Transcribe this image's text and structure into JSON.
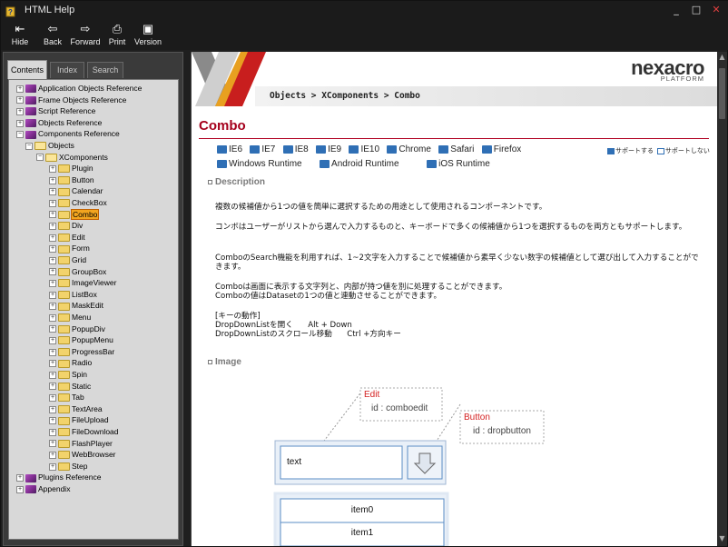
{
  "window": {
    "title": "HTML Help",
    "minimize": "_",
    "maximize": "□",
    "close": "✕"
  },
  "toolbar": [
    {
      "label": "Hide",
      "icon": "hide-icon",
      "glyph": "⇤"
    },
    {
      "label": "Back",
      "icon": "back-arrow-icon",
      "glyph": "⇦"
    },
    {
      "label": "Forward",
      "icon": "forward-arrow-icon",
      "glyph": "⇨"
    },
    {
      "label": "Print",
      "icon": "printer-icon",
      "glyph": "⎙"
    },
    {
      "label": "Version",
      "icon": "version-icon",
      "glyph": "▣"
    }
  ],
  "nav_tabs": [
    "Contents",
    "Index",
    "Search"
  ],
  "tree": [
    {
      "label": "Application Objects Reference",
      "level": 0,
      "exp": "+",
      "icon": "book"
    },
    {
      "label": "Frame Objects Reference",
      "level": 0,
      "exp": "+",
      "icon": "book"
    },
    {
      "label": "Script Reference",
      "level": 0,
      "exp": "+",
      "icon": "book"
    },
    {
      "label": "Objects Reference",
      "level": 0,
      "exp": "+",
      "icon": "book"
    },
    {
      "label": "Components Reference",
      "level": 0,
      "exp": "−",
      "icon": "openbook"
    },
    {
      "label": "Objects",
      "level": 1,
      "exp": "−",
      "icon": "openfolder"
    },
    {
      "label": "XComponents",
      "level": 2,
      "exp": "−",
      "icon": "openfolder"
    },
    {
      "label": "Plugin",
      "level": 3,
      "exp": "+",
      "icon": "folder"
    },
    {
      "label": "Button",
      "level": 3,
      "exp": "+",
      "icon": "folder"
    },
    {
      "label": "Calendar",
      "level": 3,
      "exp": "+",
      "icon": "folder"
    },
    {
      "label": "CheckBox",
      "level": 3,
      "exp": "+",
      "icon": "folder"
    },
    {
      "label": "Combo",
      "level": 3,
      "exp": "+",
      "icon": "folder",
      "selected": true
    },
    {
      "label": "Div",
      "level": 3,
      "exp": "+",
      "icon": "folder"
    },
    {
      "label": "Edit",
      "level": 3,
      "exp": "+",
      "icon": "folder"
    },
    {
      "label": "Form",
      "level": 3,
      "exp": "+",
      "icon": "folder"
    },
    {
      "label": "Grid",
      "level": 3,
      "exp": "+",
      "icon": "folder"
    },
    {
      "label": "GroupBox",
      "level": 3,
      "exp": "+",
      "icon": "folder"
    },
    {
      "label": "ImageViewer",
      "level": 3,
      "exp": "+",
      "icon": "folder"
    },
    {
      "label": "ListBox",
      "level": 3,
      "exp": "+",
      "icon": "folder"
    },
    {
      "label": "MaskEdit",
      "level": 3,
      "exp": "+",
      "icon": "folder"
    },
    {
      "label": "Menu",
      "level": 3,
      "exp": "+",
      "icon": "folder"
    },
    {
      "label": "PopupDiv",
      "level": 3,
      "exp": "+",
      "icon": "folder"
    },
    {
      "label": "PopupMenu",
      "level": 3,
      "exp": "+",
      "icon": "folder"
    },
    {
      "label": "ProgressBar",
      "level": 3,
      "exp": "+",
      "icon": "folder"
    },
    {
      "label": "Radio",
      "level": 3,
      "exp": "+",
      "icon": "folder"
    },
    {
      "label": "Spin",
      "level": 3,
      "exp": "+",
      "icon": "folder"
    },
    {
      "label": "Static",
      "level": 3,
      "exp": "+",
      "icon": "folder"
    },
    {
      "label": "Tab",
      "level": 3,
      "exp": "+",
      "icon": "folder"
    },
    {
      "label": "TextArea",
      "level": 3,
      "exp": "+",
      "icon": "folder"
    },
    {
      "label": "FileUpload",
      "level": 3,
      "exp": "+",
      "icon": "folder"
    },
    {
      "label": "FileDownload",
      "level": 3,
      "exp": "+",
      "icon": "folder"
    },
    {
      "label": "FlashPlayer",
      "level": 3,
      "exp": "+",
      "icon": "folder"
    },
    {
      "label": "WebBrowser",
      "level": 3,
      "exp": "+",
      "icon": "folder"
    },
    {
      "label": "Step",
      "level": 3,
      "exp": "+",
      "icon": "folder"
    },
    {
      "label": "Plugins Reference",
      "level": 0,
      "exp": "+",
      "icon": "book"
    },
    {
      "label": "Appendix",
      "level": 0,
      "exp": "+",
      "icon": "book"
    }
  ],
  "content": {
    "brand": "nexacro",
    "brand_sub": "PLATFORM",
    "breadcrumb": "Objects > XComponents > Combo",
    "title": "Combo",
    "browsers_row1": [
      "IE6",
      "IE7",
      "IE8",
      "IE9",
      "IE10",
      "Chrome",
      "Safari",
      "Firefox"
    ],
    "browsers_row2": [
      "Windows Runtime",
      "Android Runtime",
      "iOS Runtime"
    ],
    "legend_supported": "サポートする",
    "legend_unsupported": "サポートしない",
    "description_heading": "Description",
    "description": [
      "複数の候補値から1つの値を簡単に選択するための用途として使用されるコンポーネントです。",
      "コンボはユーザーがリストから選んで入力するものと、キーボードで多くの候補値から1つを選択するものを両方ともサポートします。",
      "ComboのSearch機能を利用すれば、1~2文字を入力することで候補値から素早く少ない数字の候補値として選び出して入力することができます。",
      "Comboは画面に表示する文字列と、内部が持つ値を別に処理することができます。\nComboの値はDatasetの1つの値と連動させることができます。",
      "[キーの動作]\nDropDownListを開く      Alt + Down\nDropDownListのスクロール移動      Ctrl +方向キー"
    ],
    "image_heading": "Image",
    "diagram": {
      "edit_label": "Edit",
      "edit_id": "id : comboedit",
      "button_label": "Button",
      "button_id": "id : dropbutton",
      "combo_text": "text",
      "items": [
        "item0",
        "item1"
      ]
    }
  },
  "colors": {
    "title_red": "#a5001c",
    "selected": "#f2a51f",
    "supported_blue": "#2f6fb5"
  }
}
